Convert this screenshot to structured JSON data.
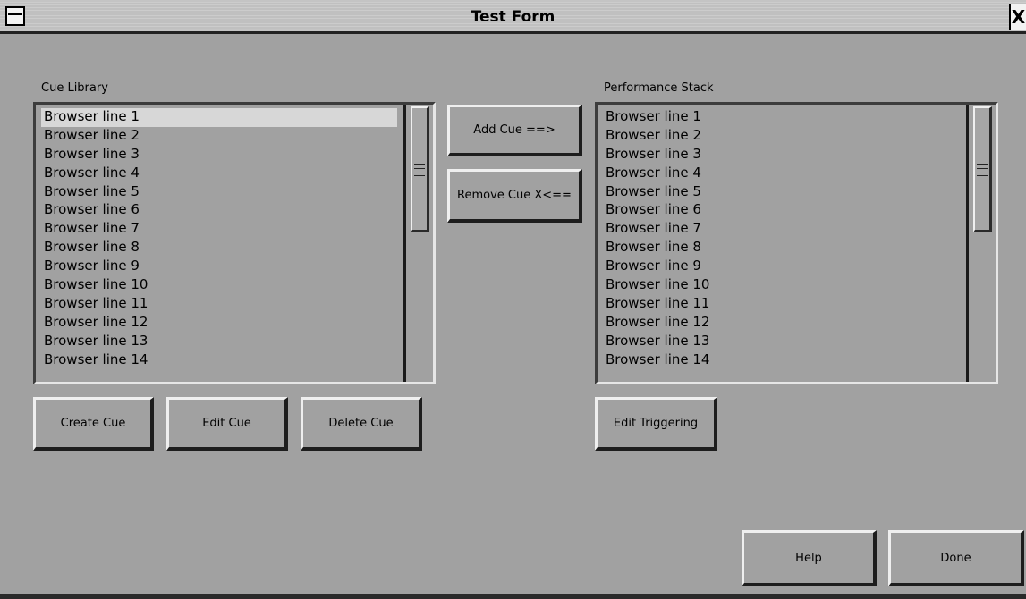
{
  "window": {
    "title": "Test Form",
    "close_glyph": "X"
  },
  "cue_library": {
    "label": "Cue Library",
    "items": [
      "Browser line 1",
      "Browser line 2",
      "Browser line 3",
      "Browser line 4",
      "Browser line 5",
      "Browser line 6",
      "Browser line 7",
      "Browser line 8",
      "Browser line 9",
      "Browser line 10",
      "Browser line 11",
      "Browser line 12",
      "Browser line 13",
      "Browser line 14"
    ],
    "selected_index": 0
  },
  "performance_stack": {
    "label": "Performance Stack",
    "items": [
      "Browser line 1",
      "Browser line 2",
      "Browser line 3",
      "Browser line 4",
      "Browser line 5",
      "Browser line 6",
      "Browser line 7",
      "Browser line 8",
      "Browser line 9",
      "Browser line 10",
      "Browser line 11",
      "Browser line 12",
      "Browser line 13",
      "Browser line 14"
    ]
  },
  "buttons": {
    "add_cue": "Add Cue ==>",
    "remove_cue": "Remove Cue  X<==",
    "create_cue": "Create Cue",
    "edit_cue": "Edit Cue",
    "delete_cue": "Delete Cue",
    "edit_triggering": "Edit Triggering",
    "help": "Help",
    "done": "Done"
  },
  "icons": {
    "window_menu": "window-menu-icon",
    "close": "close-icon",
    "scroll_grip": "scroll-grip-icon"
  }
}
